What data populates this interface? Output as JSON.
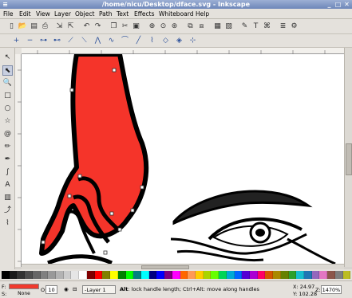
{
  "window": {
    "title": "/home/nicu/Desktop/dface.svg - Inkscape"
  },
  "menu": [
    "File",
    "Edit",
    "View",
    "Layer",
    "Object",
    "Path",
    "Text",
    "Effects",
    "Whiteboard",
    "Help"
  ],
  "toolbar_icons": [
    "new-document-icon",
    "open-icon",
    "save-icon",
    "print-icon",
    "import-icon",
    "export-icon",
    "undo-icon",
    "redo-icon",
    "copy-icon",
    "cut-icon",
    "paste-icon",
    "zoom-selection-icon",
    "zoom-drawing-icon",
    "zoom-page-icon",
    "duplicate-icon",
    "clone-icon",
    "group-icon",
    "ungroup-icon",
    "fill-stroke-icon",
    "text-font-icon",
    "xml-editor-icon",
    "align-icon",
    "preferences-icon"
  ],
  "node_toolbar_icons": [
    "insert-node-icon",
    "delete-node-icon",
    "join-nodes-icon",
    "break-path-icon",
    "join-segment-icon",
    "delete-segment-icon",
    "make-cusp-icon",
    "make-smooth-icon",
    "make-symmetric-icon",
    "line-segment-icon",
    "curve-segment-icon",
    "object-to-path-icon",
    "stroke-to-path-icon",
    "show-handles-icon"
  ],
  "tools": [
    "selector-tool",
    "node-tool",
    "zoom-tool",
    "rectangle-tool",
    "ellipse-tool",
    "star-tool",
    "spiral-tool",
    "pencil-tool",
    "pen-tool",
    "calligraphy-tool",
    "text-tool",
    "gradient-tool",
    "connector-tool",
    "dropper-tool"
  ],
  "palette": [
    "#000000",
    "#1a1a1a",
    "#333333",
    "#4d4d4d",
    "#666666",
    "#808080",
    "#999999",
    "#b3b3b3",
    "#cccccc",
    "#e6e6e6",
    "#ffffff",
    "#800000",
    "#ff0000",
    "#808000",
    "#ffff00",
    "#008000",
    "#00ff00",
    "#008080",
    "#00ffff",
    "#000080",
    "#0000ff",
    "#800080",
    "#ff00ff",
    "#ff6600",
    "#ff9955",
    "#ffcc00",
    "#aad400",
    "#66ff00",
    "#00d455",
    "#00aad4",
    "#0066ff",
    "#5500d4",
    "#aa00d4",
    "#ff0066",
    "#d45500",
    "#aa8800",
    "#668000",
    "#2ca02c",
    "#17becf",
    "#1f77b4",
    "#9467bd",
    "#e377c2",
    "#8c564b",
    "#7f7f7f",
    "#bcbd22"
  ],
  "status": {
    "fill_label": "F:",
    "stroke_label": "S:",
    "stroke_value": "None",
    "fill_color": "#f03a2e",
    "opacity_label": "O:",
    "opacity_value": "10",
    "layer_value": "-Layer 1",
    "message_bold": "Alt",
    "message": ": lock handle length; Ctrl+Alt: move along handles",
    "cursor_x": "X: 24.97",
    "cursor_y": "Y: 102.28",
    "zoom_label": "Z:",
    "zoom_value": "1470%"
  }
}
